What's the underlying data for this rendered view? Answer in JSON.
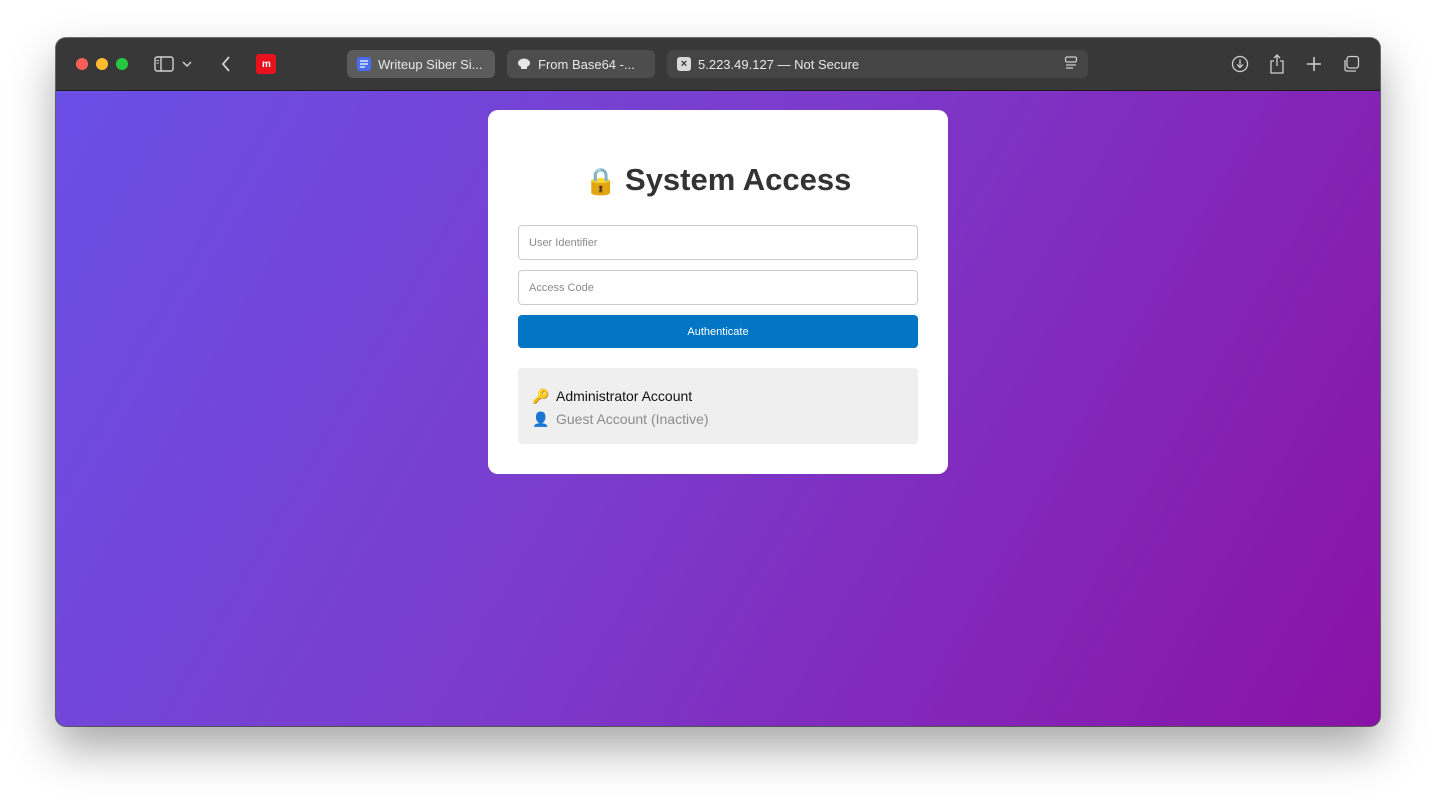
{
  "browser": {
    "tabs": [
      {
        "title": "Writeup Siber Si...",
        "icon": "docs-icon"
      },
      {
        "title": "From Base64 -...",
        "icon": "chef-hat-icon"
      },
      {
        "title": "5.223.49.127 — Not Secure",
        "icon": "insecure-icon"
      }
    ],
    "app_icon_text": "m"
  },
  "login": {
    "title_emoji": "🔒",
    "title": "System Access",
    "user_placeholder": "User Identifier",
    "code_placeholder": "Access Code",
    "button_label": "Authenticate"
  },
  "accounts": [
    {
      "icon": "🔑",
      "label": "Administrator Account",
      "status": "active"
    },
    {
      "icon": "👤",
      "label": "Guest Account (Inactive)",
      "status": "inactive"
    }
  ],
  "colors": {
    "gradient_start": "#6a4fe6",
    "gradient_end": "#8a12a6",
    "button": "#0275c4"
  }
}
